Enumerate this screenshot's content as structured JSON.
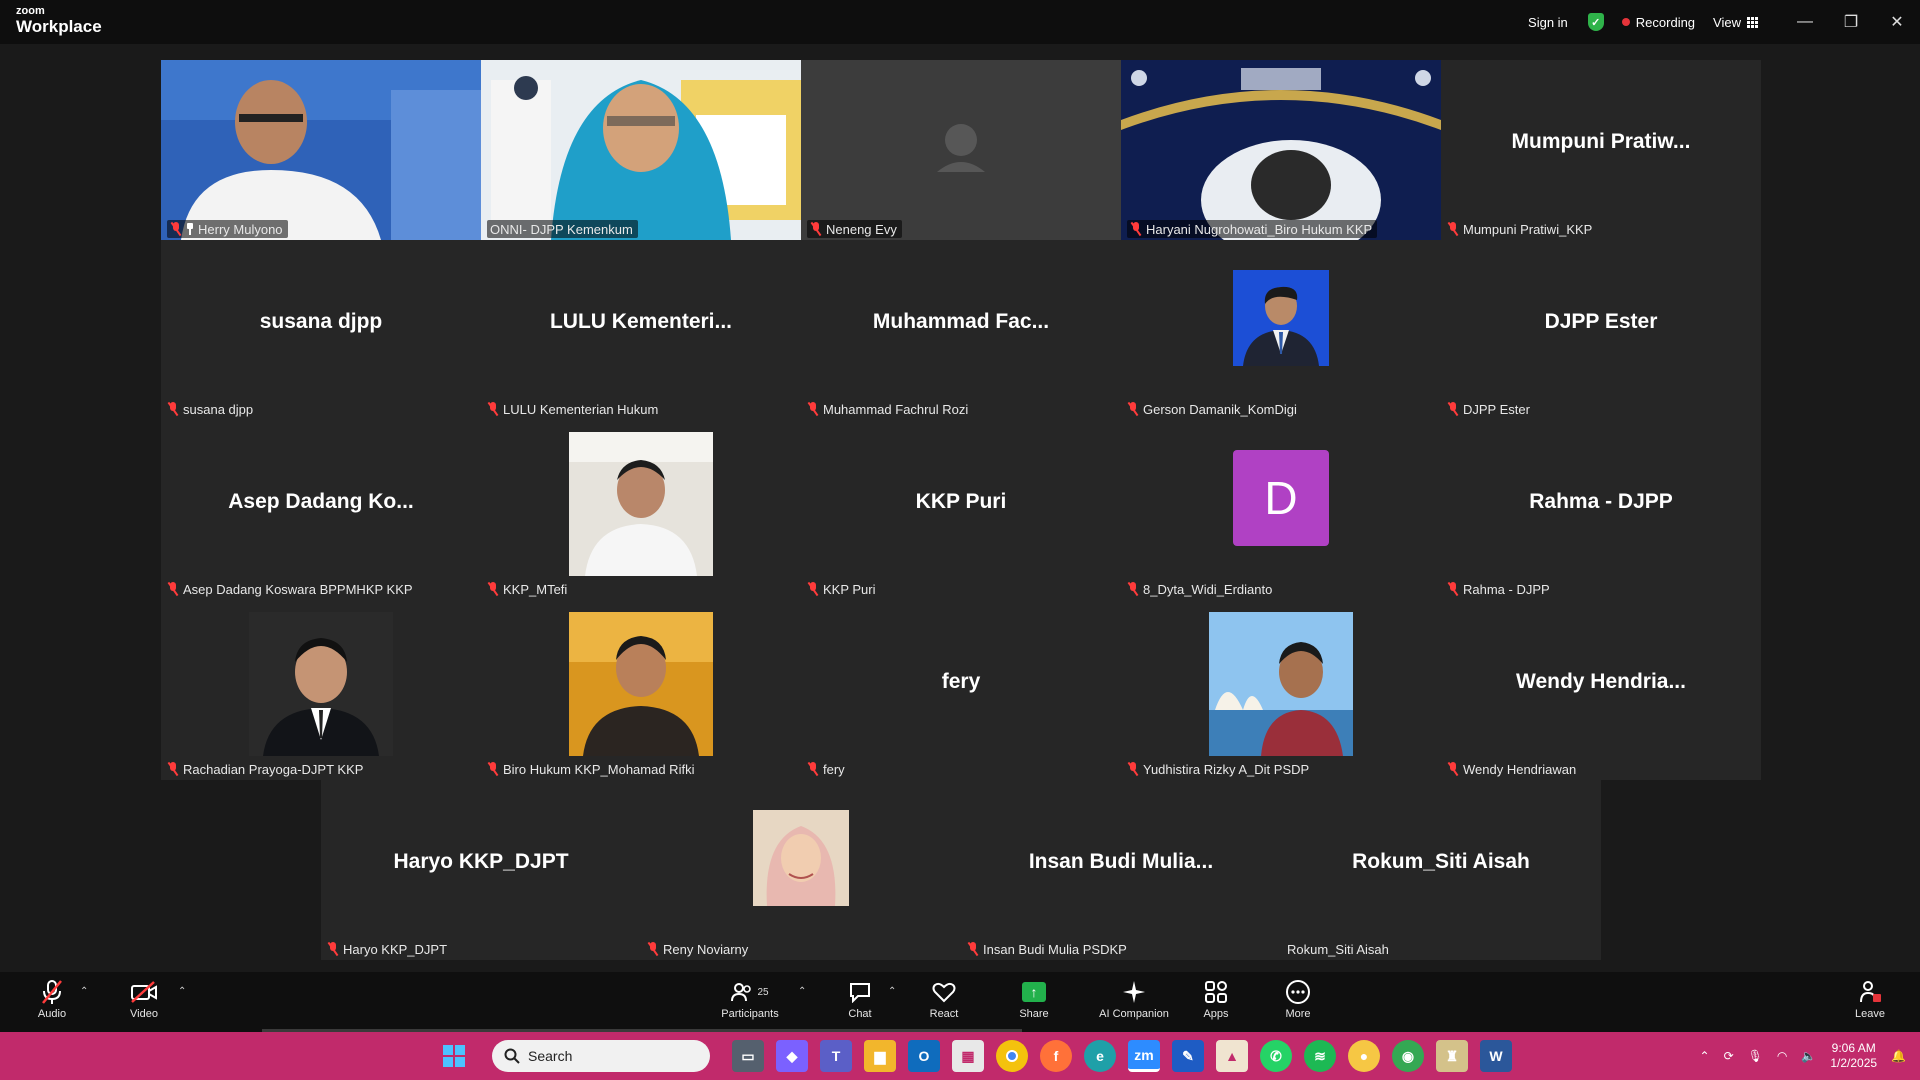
{
  "app": {
    "brand_top": "zoom",
    "brand_bottom": "Workplace"
  },
  "titlebar": {
    "sign_in": "Sign in",
    "recording": "Recording",
    "view": "View"
  },
  "gallery": {
    "tiles": [
      {
        "big": "",
        "label": "Herry Mulyono",
        "pinned": true,
        "video": "photo"
      },
      {
        "big": "",
        "label": "ONNI- DJPP Kemenkum",
        "video": "photo",
        "active": true
      },
      {
        "big": "",
        "label": "Neneng Evy",
        "video": "blank"
      },
      {
        "big": "",
        "label": "Haryani Nugrohowati_Biro Hukum KKP",
        "video": "screen"
      },
      {
        "big": "Mumpuni  Pratiw...",
        "label": "Mumpuni Pratiwi_KKP"
      },
      {
        "big": "susana  djpp",
        "label": "susana djpp"
      },
      {
        "big": "LULU  Kementeri...",
        "label": "LULU Kementerian Hukum"
      },
      {
        "big": "Muhammad  Fac...",
        "label": "Muhammad Fachrul Rozi"
      },
      {
        "big": "",
        "label": "Gerson Damanik_KomDigi",
        "video": "avatar-blue"
      },
      {
        "big": "DJPP  Ester",
        "label": "DJPP Ester"
      },
      {
        "big": "Asep  Dadang  Ko...",
        "label": "Asep Dadang Koswara BPPMHKP KKP"
      },
      {
        "big": "",
        "label": "KKP_MTefi",
        "video": "avatar-light"
      },
      {
        "big": "KKP  Puri",
        "label": "KKP Puri"
      },
      {
        "big": "",
        "label": "8_Dyta_Widi_Erdianto",
        "letter": "D"
      },
      {
        "big": "Rahma  -  DJPP",
        "label": "Rahma - DJPP"
      },
      {
        "big": "",
        "label": "Rachadian Prayoga-DJPT KKP",
        "video": "avatar-dark"
      },
      {
        "big": "",
        "label": "Biro Hukum KKP_Mohamad Rifki",
        "video": "avatar-warm"
      },
      {
        "big": "fery",
        "label": "fery"
      },
      {
        "big": "",
        "label": "Yudhistira Rizky A_Dit PSDP",
        "video": "avatar-sky"
      },
      {
        "big": "Wendy  Hendria...",
        "label": "Wendy Hendriawan"
      },
      {
        "big": "Haryo  KKP_DJPT",
        "label": "Haryo KKP_DJPT"
      },
      {
        "big": "",
        "label": "Reny Noviarny",
        "video": "avatar-pink"
      },
      {
        "big": "Insan  Budi  Mulia...",
        "label": "Insan Budi Mulia PSDKP"
      },
      {
        "big": "Rokum_Siti  Aisah",
        "label": "Rokum_Siti Aisah",
        "unmuted": true
      }
    ]
  },
  "toolbar": {
    "audio": "Audio",
    "video": "Video",
    "participants": "Participants",
    "participants_count": "25",
    "chat": "Chat",
    "react": "React",
    "share": "Share",
    "ai": "AI Companion",
    "apps": "Apps",
    "more": "More",
    "leave": "Leave"
  },
  "taskbar": {
    "search": "Search",
    "time": "9:06 AM",
    "date": "1/2/2025"
  },
  "colors": {
    "accent_green": "#2bd46b",
    "zoom_blue": "#2d8cff",
    "taskbar": "#c12a6b",
    "mute_red": "#ff3b3b"
  }
}
